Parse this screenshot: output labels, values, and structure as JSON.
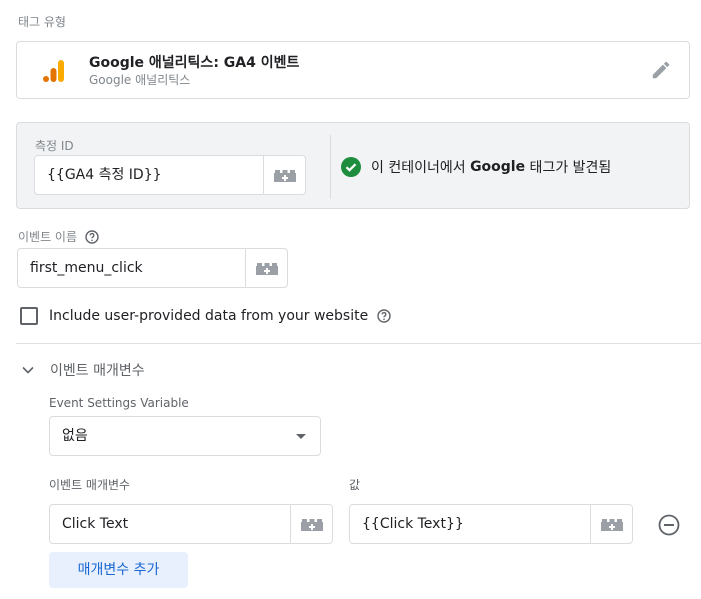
{
  "section_label": "태그 유형",
  "tag_type": {
    "title": "Google 애널리틱스: GA4 이벤트",
    "subtitle": "Google 애널리틱스",
    "logo_icon": "google-analytics-icon",
    "edit_icon": "pencil-icon"
  },
  "measurement": {
    "label": "측정 ID",
    "value": "{{GA4 측정 ID}}",
    "status_prefix": "이 컨테이너에서 ",
    "status_bold": "Google",
    "status_suffix": " 태그가 발견됨",
    "status_color": "#1e8e3e"
  },
  "event_name": {
    "label": "이벤트 이름",
    "value": "first_menu_click"
  },
  "user_data_checkbox": {
    "label": "Include user-provided data from your website",
    "checked": false
  },
  "event_params": {
    "header": "이벤트 매개변수",
    "settings_variable_label": "Event Settings Variable",
    "settings_variable_value": "없음",
    "param_col_label": "이벤트 매개변수",
    "value_col_label": "값",
    "rows": [
      {
        "name": "Click Text",
        "value": "{{Click Text}}"
      }
    ],
    "add_button": "매개변수 추가"
  },
  "colors": {
    "accent": "#1967d2",
    "accent_bg": "#e8f0fe",
    "ga_orange": "#f9ab00",
    "ga_dark_orange": "#e37400"
  }
}
